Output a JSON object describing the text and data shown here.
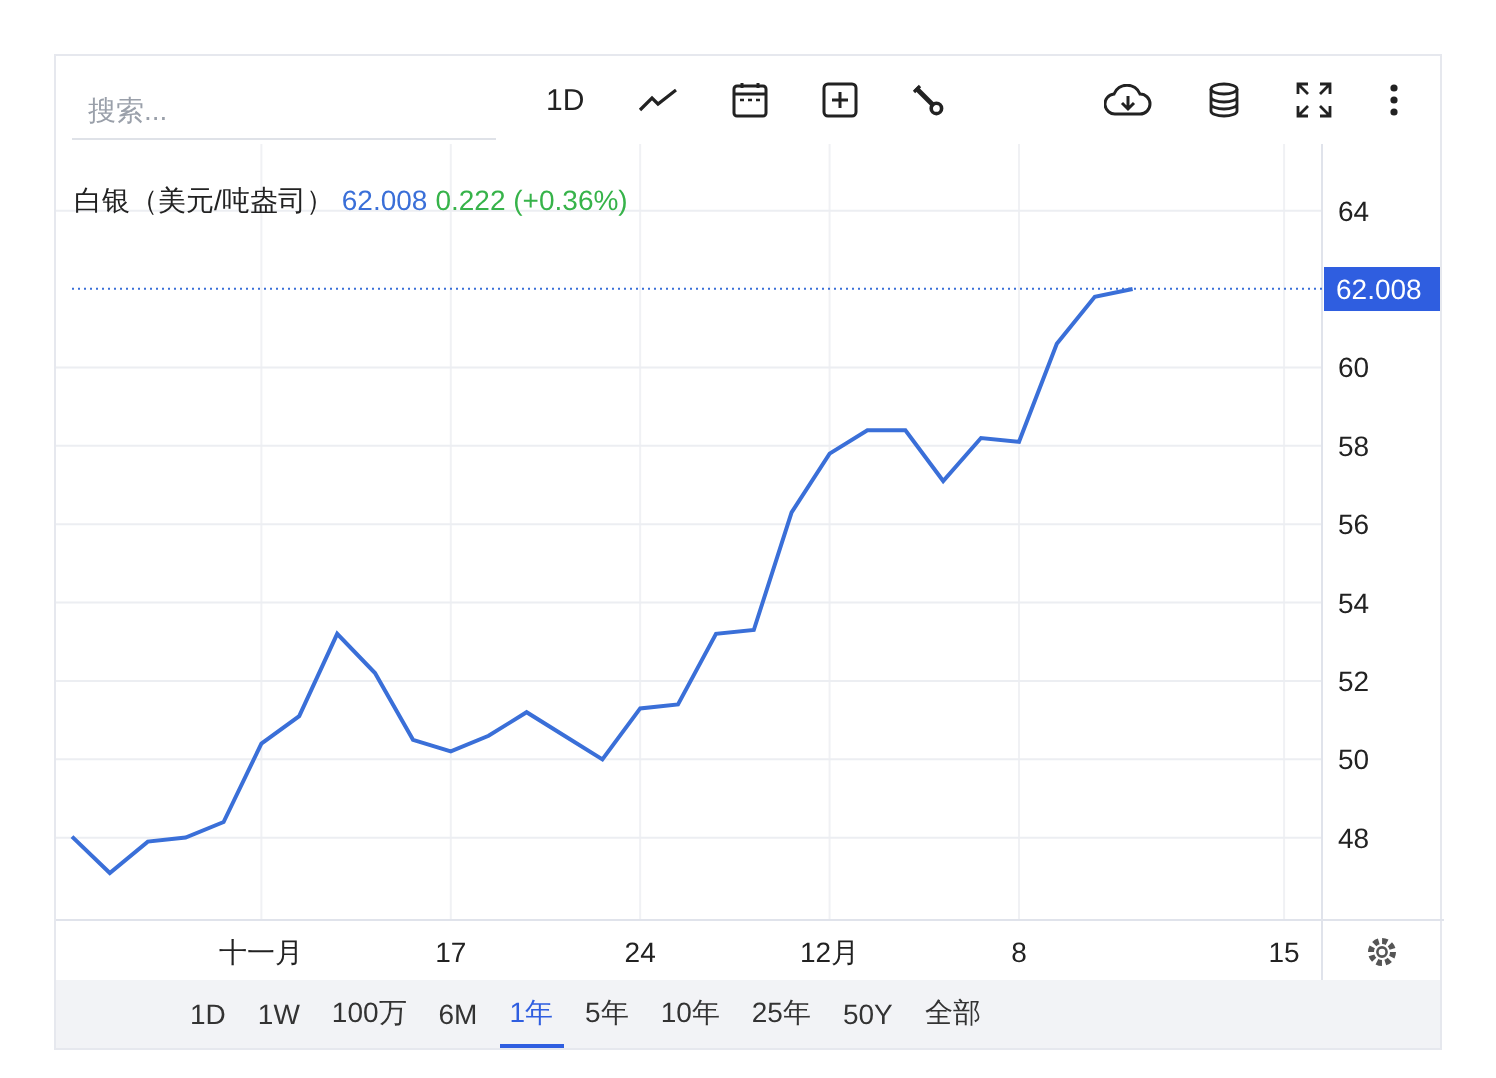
{
  "toolbar": {
    "search": {
      "placeholder": "搜索..."
    },
    "interval": "1D"
  },
  "legend": {
    "symbol": "白银（美元/吨盎司）",
    "price": "62.008",
    "change": "0.222 (+0.36%)"
  },
  "price_label": "62.008",
  "chart_data": {
    "type": "line",
    "categories": [
      null,
      null,
      null,
      null,
      null,
      "十一月",
      null,
      null,
      null,
      null,
      "17",
      null,
      null,
      null,
      null,
      "24",
      null,
      null,
      null,
      null,
      "12月",
      null,
      null,
      null,
      null,
      "8",
      null,
      null,
      null,
      null,
      null,
      null,
      "15",
      null
    ],
    "series": [
      {
        "color": "#3a6fd8",
        "values": [
          48.03,
          47.1,
          47.9,
          48.0,
          48.4,
          50.4,
          51.1,
          53.2,
          52.2,
          50.5,
          50.2,
          50.6,
          51.2,
          50.6,
          50.0,
          51.3,
          51.4,
          53.2,
          53.3,
          56.3,
          57.8,
          58.4,
          58.4,
          57.1,
          58.2,
          58.1,
          60.6,
          61.8,
          62.0,
          null,
          null,
          null,
          null,
          null
        ]
      }
    ],
    "ylim": [
      45.9,
      65.7
    ],
    "grid": true,
    "ref_lines": [
      {
        "axis": "y",
        "value": 62.008
      }
    ],
    "yticks": [
      48,
      50,
      52,
      54,
      56,
      58,
      60,
      64
    ]
  },
  "ranges": [
    {
      "label": "1D",
      "selected": false
    },
    {
      "label": "1W",
      "selected": false
    },
    {
      "label": "100万",
      "selected": false
    },
    {
      "label": "6M",
      "selected": false
    },
    {
      "label": "1年",
      "selected": true
    },
    {
      "label": "5年",
      "selected": false
    },
    {
      "label": "10年",
      "selected": false
    },
    {
      "label": "25年",
      "selected": false
    },
    {
      "label": "50Y",
      "selected": false
    },
    {
      "label": "全部",
      "selected": false
    }
  ]
}
